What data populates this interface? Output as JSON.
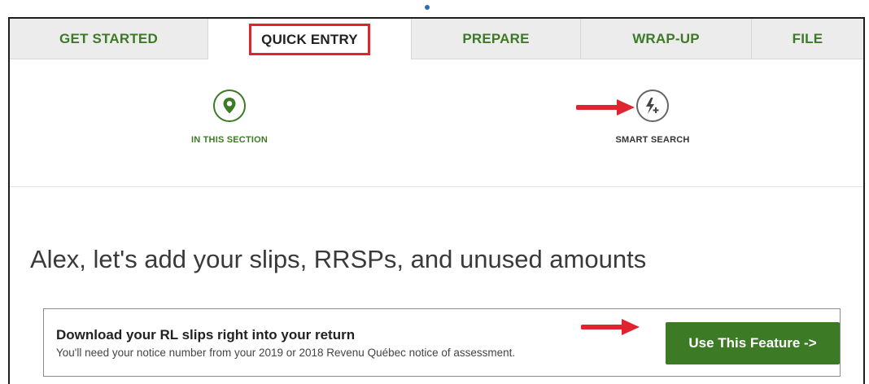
{
  "tabs": [
    {
      "label": "GET STARTED",
      "active": false
    },
    {
      "label": "QUICK ENTRY",
      "active": true
    },
    {
      "label": "PREPARE",
      "active": false
    },
    {
      "label": "WRAP-UP",
      "active": false
    },
    {
      "label": "FILE",
      "active": false
    }
  ],
  "section_tools": {
    "in_this_section": {
      "label": "IN THIS SECTION",
      "icon": "map-pin-icon"
    },
    "smart_search": {
      "label": "SMART SEARCH",
      "icon": "lightning-plus-icon"
    }
  },
  "main": {
    "heading": "Alex, let's add your slips, RRSPs, and unused amounts"
  },
  "feature_card": {
    "title": "Download your RL slips right into your return",
    "subtitle": "You'll need your notice number from your 2019 or 2018 Revenu Québec notice of assessment.",
    "button_label": "Use This Feature ->"
  },
  "colors": {
    "brand_green": "#3d7a26",
    "annotation_red": "#e0242f",
    "tab_background": "#ececec"
  }
}
